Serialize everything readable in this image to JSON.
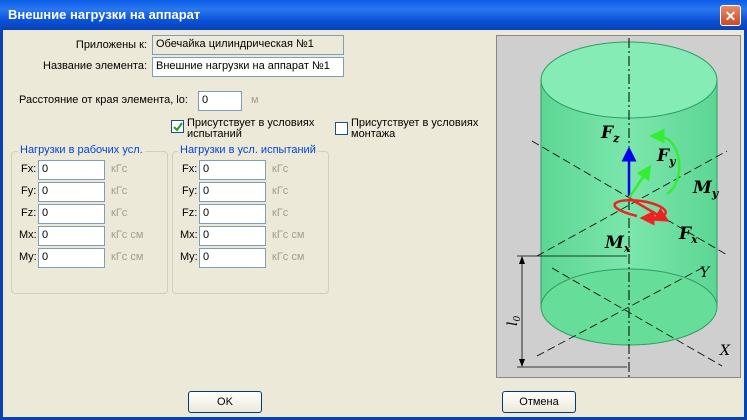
{
  "window": {
    "title": "Внешние нагрузки на аппарат",
    "close_glyph": "✕"
  },
  "form": {
    "attached_label": "Приложены к:",
    "attached_value": "Обечайка цилиндрическая №1",
    "name_label": "Название элемента:",
    "name_value": "Внешние нагрузки на аппарат №1",
    "distance_label": "Расстояние от края элемента, lo:",
    "distance_value": "0",
    "distance_unit": "м",
    "test_conditions_label_1": "Присутствует в условиях",
    "test_conditions_label_2": "испытаний",
    "test_conditions_checked": true,
    "mount_conditions_label_1": "Присутствует в условиях",
    "mount_conditions_label_2": "монтажа",
    "mount_conditions_checked": false
  },
  "working_loads": {
    "title": "Нагрузки в рабочих усл.",
    "rows": [
      {
        "label": "Fx:",
        "value": "0",
        "unit": "кГс"
      },
      {
        "label": "Fy:",
        "value": "0",
        "unit": "кГс"
      },
      {
        "label": "Fz:",
        "value": "0",
        "unit": "кГс"
      },
      {
        "label": "Mx:",
        "value": "0",
        "unit": "кГс см"
      },
      {
        "label": "My:",
        "value": "0",
        "unit": "кГс см"
      }
    ]
  },
  "test_loads": {
    "title": "Нагрузки в усл. испытаний",
    "rows": [
      {
        "label": "Fx:",
        "value": "0",
        "unit": "кГс"
      },
      {
        "label": "Fy:",
        "value": "0",
        "unit": "кГс"
      },
      {
        "label": "Fz:",
        "value": "0",
        "unit": "кГс"
      },
      {
        "label": "Mx:",
        "value": "0",
        "unit": "кГс см"
      },
      {
        "label": "My:",
        "value": "0",
        "unit": "кГс см"
      }
    ]
  },
  "diagram": {
    "fz": "F",
    "fz_sub": "z",
    "fy": "F",
    "fy_sub": "y",
    "my": "M",
    "my_sub": "y",
    "mx": "M",
    "mx_sub": "x",
    "fx": "F",
    "fx_sub": "x",
    "axis_y": "Y",
    "axis_x": "X",
    "lo": "l",
    "lo_sub": "0",
    "colors": {
      "cylinder": "#66dd99",
      "fz_arrow": "#0000ee",
      "fy_arrow": "#33ee33",
      "fx_arrow": "#ee2222"
    }
  },
  "buttons": {
    "ok": "OK",
    "cancel": "Отмена"
  }
}
